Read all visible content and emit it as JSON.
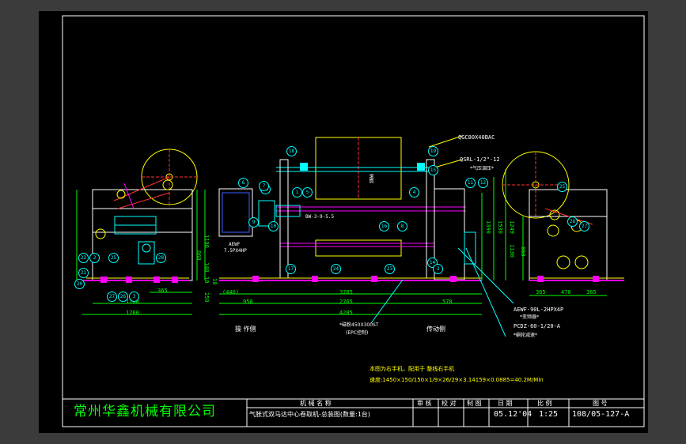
{
  "drawing": {
    "company": "常州华鑫机械有限公司",
    "machine_name_header": "机 械 名 称",
    "machine_name": "气胀式双马达中心卷取机-总装图(数量:1台)",
    "title_headers": [
      "审 核",
      "校 对",
      "制 图",
      "日 期",
      "比 例",
      "图 号"
    ],
    "date": "05.12'04",
    "scale": "1:25",
    "drawing_number": "108/05-127-A",
    "notes": [
      "本图为右手机，配用于 整线右手机",
      "速度:1450×150/150×1/9×26/29×3.14159×0.0885=40.2M/Min"
    ]
  },
  "callouts": {
    "left_view": [
      "22",
      "2",
      "21",
      "20",
      "25",
      "26",
      "27",
      "3",
      "28"
    ],
    "front_view": [
      "18",
      "19",
      "5",
      "13",
      "14",
      "15",
      "4",
      "16",
      "1",
      "11",
      "12",
      "9",
      "10",
      "8",
      "7",
      "6",
      "17",
      "24",
      "23",
      "3"
    ],
    "right_view": [
      "25",
      "26",
      "27"
    ]
  },
  "labels": {
    "air_cylinder": "QGC80X40BAC",
    "air_valve": "QSRL-1/2\"-12",
    "brake_note": "*气压调压*",
    "motor": "AEWF",
    "motor_power": "7.5PX4HP",
    "reducer": "BW-3-9-5.5",
    "roller_label": "滚筒",
    "epc": "*磁粉450X300ST",
    "epc2": "(EPC控制)",
    "motor2": "AEWF-90L-2HPX4P",
    "motor2_note": "*变频器*",
    "pcd": "PCDZ-60-1/20-A",
    "pcd_note": "*蜗轮减速*",
    "operation_side": "操 作侧",
    "drive_side": "传动侧"
  },
  "dimensions": {
    "left_view": [
      "1160",
      "1260",
      "365",
      "860",
      "1190",
      "140",
      "10",
      "259",
      "10"
    ],
    "front_view": [
      "(440)",
      "3785",
      "950",
      "2765",
      "570",
      "4285"
    ],
    "front_right_heights": [
      "1390",
      "1530",
      "1249",
      "1130"
    ],
    "right_view": [
      "365",
      "470",
      "365",
      "860"
    ]
  },
  "colors": {
    "background": "#000000",
    "frame": "#ffffff",
    "cyan": "#00ffff",
    "yellow": "#ffff00",
    "magenta": "#ff00ff",
    "green": "#00ff00",
    "red": "#ff3030",
    "blue": "#4060ff"
  }
}
